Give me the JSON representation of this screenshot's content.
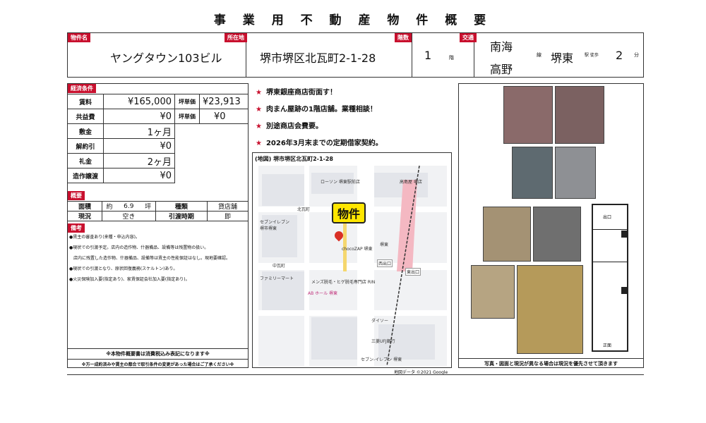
{
  "title": "事 業 用 不 動 産 物 件 概 要",
  "header": {
    "property_name_label": "物件名",
    "property_name": "ヤングタウン103ビル",
    "location_label": "所在地",
    "location": "堺市堺区北瓦町2-1-28",
    "floor_label": "階数",
    "floor_value": "1",
    "floor_unit": "階",
    "transport_label": "交通",
    "line_name_1": "南海",
    "line_name_2": "高野",
    "line_unit": "線",
    "station": "堺東",
    "station_unit": "駅 徒歩",
    "walk_minutes": "2",
    "minute_unit": "分"
  },
  "conditions": {
    "section_label": "経済条件",
    "rent_label": "賃料",
    "rent": "¥165,000",
    "tsubo_label_1": "坪単価",
    "tsubo_value_1": "¥23,913",
    "common_label": "共益費",
    "common": "¥0",
    "tsubo_label_2": "坪単価",
    "tsubo_value_2": "¥0",
    "deposit_label": "敷金",
    "deposit": "1ヶ月",
    "cancel_label": "解約引",
    "cancel": "¥0",
    "key_money_label": "礼金",
    "key_money": "2ヶ月",
    "fixture_label": "造作譲渡",
    "fixture": "¥0"
  },
  "overview": {
    "section_label": "概要",
    "area_label": "面積",
    "area_prefix": "約",
    "area_value": "6.9",
    "area_unit": "坪",
    "type_label": "種類",
    "type_value": "貸店舗",
    "status_label": "現況",
    "status_value": "空き",
    "handover_label": "引渡時期",
    "handover_value": "即"
  },
  "remarks": {
    "section_label": "備考",
    "lines": [
      "●賃主の審査あり(来種・申込内容)。",
      "●現状での引渡予定。店内の造作物、什器備品、設備等は残置物の扱い。",
      "　店内に残置した造作物、什器備品、設備等は賃主の性能保証はなし。現地要確認。",
      "●現状での引渡となり、原状回復義務(スケルトン)あり。",
      "●火災保険加入要(指定あり)、家賃保証会社加入要(指定あり)。"
    ],
    "tax_note": "※本物件概要書は消費税込み表記になります※",
    "change_note": "※万一成約済みや賃主の都合で取引条件の変更があった場合はご了承ください※"
  },
  "highlights": [
    "堺東銀座商店街面す！",
    "肉まん屋跡の1階店舗。業種相談！",
    "別途商店会費要。",
    "2026年3月末までの定期借家契約。"
  ],
  "map": {
    "heading": "(地図) 堺市堺区北瓦町2-1-28",
    "marker_label": "物件",
    "credit": "地図データ ©2021 Google",
    "places": [
      "ローソン 堺東駅前店",
      "高島屋 堺店",
      "北瓦町",
      "セブンイレブン 堺市堺東",
      "chocoZAP 堺東",
      "堺東",
      "西出口",
      "東出口",
      "中瓦町",
      "ファミリーマート",
      "AB ホール 堺東",
      "メンズ脱毛・ヒゲ脱毛専門店 RIN",
      "ダイソー",
      "三菱UFJ銀行",
      "セブン-イレブン 堺東"
    ]
  },
  "photos": {
    "entrance_label": "出口",
    "front_label": "正面",
    "caption": "写真・図面と現況が異なる場合は現況を優先させて頂きます"
  },
  "colors": {
    "accent_red": "#c8102e",
    "marker_yellow": "#ffe600"
  }
}
